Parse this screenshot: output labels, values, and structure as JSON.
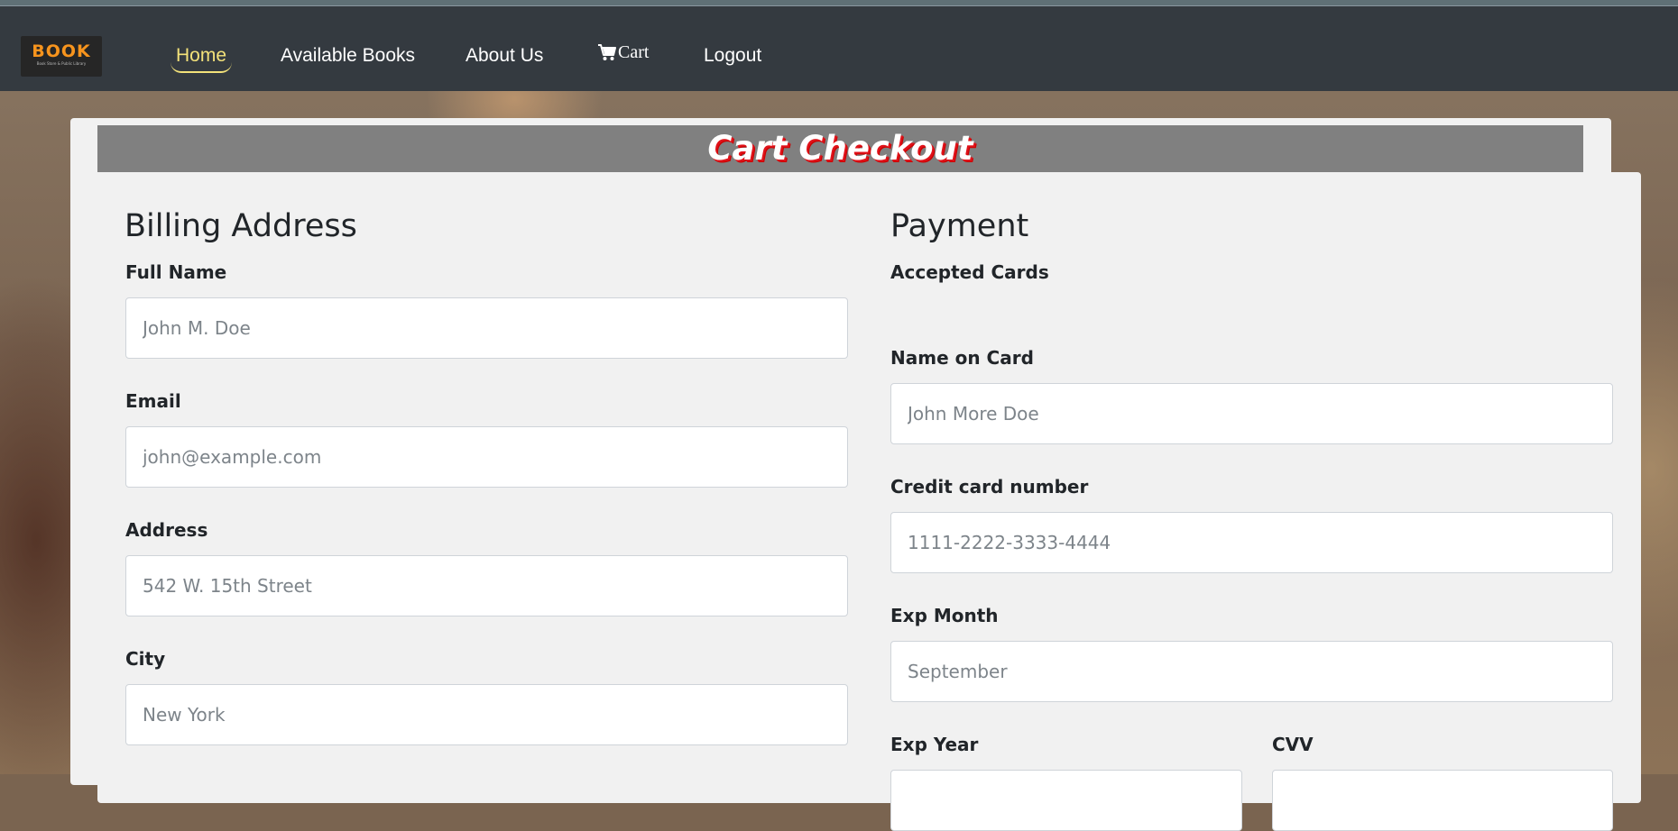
{
  "brand": {
    "logo_word": "BOOK",
    "logo_sub": "Book Store & Public Library"
  },
  "nav": {
    "home": "Home",
    "available_books": "Available Books",
    "about_us": "About Us",
    "cart": "Cart",
    "logout": "Logout"
  },
  "page": {
    "title": "Cart Checkout"
  },
  "billing": {
    "heading": "Billing Address",
    "full_name": {
      "label": "Full Name",
      "placeholder": "John M. Doe"
    },
    "email": {
      "label": "Email",
      "placeholder": "john@example.com"
    },
    "address": {
      "label": "Address",
      "placeholder": "542 W. 15th Street"
    },
    "city": {
      "label": "City",
      "placeholder": "New York"
    }
  },
  "payment": {
    "heading": "Payment",
    "accepted_cards_label": "Accepted Cards",
    "name_on_card": {
      "label": "Name on Card",
      "placeholder": "John More Doe"
    },
    "card_number": {
      "label": "Credit card number",
      "placeholder": "1111-2222-3333-4444"
    },
    "exp_month": {
      "label": "Exp Month",
      "placeholder": "September"
    },
    "exp_year": {
      "label": "Exp Year"
    },
    "cvv": {
      "label": "CVV"
    }
  },
  "colors": {
    "navbar": "#343a40",
    "nav_active": "#f3e27a",
    "logo_accent": "#f7941d",
    "title_bar": "#808080",
    "title_shadow": "#e0121a",
    "card": "#f1f1f1"
  }
}
